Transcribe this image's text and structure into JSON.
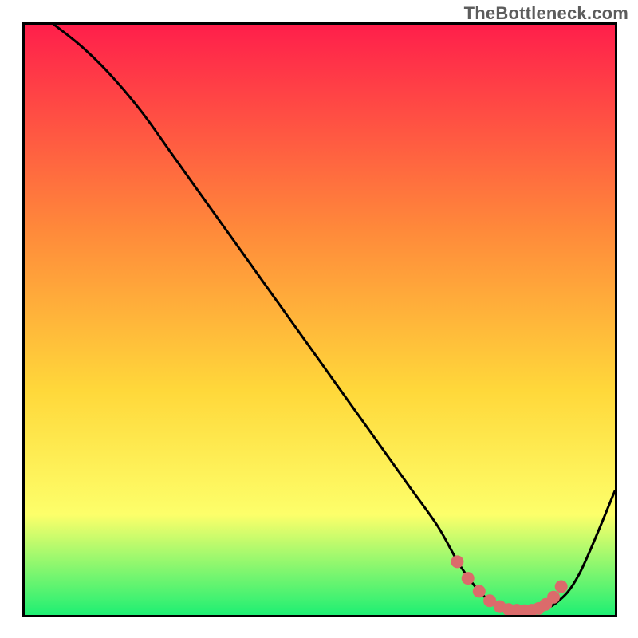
{
  "watermark": "TheBottleneck.com",
  "palette": {
    "gradient_top": "#ff1f4b",
    "gradient_mid1": "#ff8a3a",
    "gradient_mid2": "#ffd83a",
    "gradient_mid3": "#fdff6a",
    "gradient_bottom": "#1fef73",
    "curve_color": "#000000",
    "datapoint_color": "#db6b6b",
    "frame_color": "#000000"
  },
  "chart_data": {
    "type": "line",
    "title": "",
    "xlabel": "",
    "ylabel": "",
    "xlim": [
      0,
      100
    ],
    "ylim": [
      0,
      100
    ],
    "series": [
      {
        "name": "bottleneck-curve",
        "x": [
          5,
          10,
          15,
          20,
          25,
          30,
          35,
          40,
          45,
          50,
          55,
          60,
          65,
          70,
          74,
          78,
          82,
          86,
          90,
          94,
          100
        ],
        "values": [
          100,
          96,
          91,
          85,
          78,
          71,
          64,
          57,
          50,
          43,
          36,
          29,
          22,
          15,
          8,
          3,
          0.8,
          0.6,
          2,
          7,
          21
        ]
      }
    ],
    "highlight_points": {
      "name": "valley-dots",
      "x": [
        73.3,
        75.1,
        77.0,
        78.8,
        80.5,
        82.0,
        83.4,
        84.7,
        85.9,
        87.1,
        88.3,
        89.6,
        90.9
      ],
      "values": [
        9.0,
        6.2,
        4.0,
        2.4,
        1.4,
        0.9,
        0.8,
        0.7,
        0.8,
        1.1,
        1.8,
        3.0,
        4.8
      ]
    }
  }
}
